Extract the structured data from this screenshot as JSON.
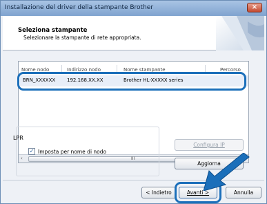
{
  "window": {
    "title": "Installazione del driver della stampante Brother",
    "close_symbol": "×"
  },
  "header": {
    "title": "Seleziona stampante",
    "subtitle": "Selezionare la stampante di rete appropriata."
  },
  "table": {
    "columns": [
      "Nome nodo",
      "Indirizzo nodo",
      "Nome stampante",
      "Percorso"
    ],
    "rows": [
      {
        "node_name": "BRN_XXXXXX",
        "node_address": "192.168.XX.XX",
        "printer_name": "Brother HL-XXXXX series",
        "path": ""
      }
    ],
    "scroll_left": "‹",
    "scroll_right": "›",
    "scroll_grip": "III"
  },
  "lpr": {
    "title": "LPR",
    "checkbox_label": "Imposta per nome di nodo",
    "checked": true,
    "check_mark": "✓"
  },
  "buttons": {
    "configure_ip": "Configura IP",
    "refresh": "Aggiorna",
    "back": "< Indietro",
    "next": "Avanti >",
    "cancel": "Annulla"
  },
  "colors": {
    "highlight": "#1b6fba",
    "arrow": "#1b6fba"
  }
}
